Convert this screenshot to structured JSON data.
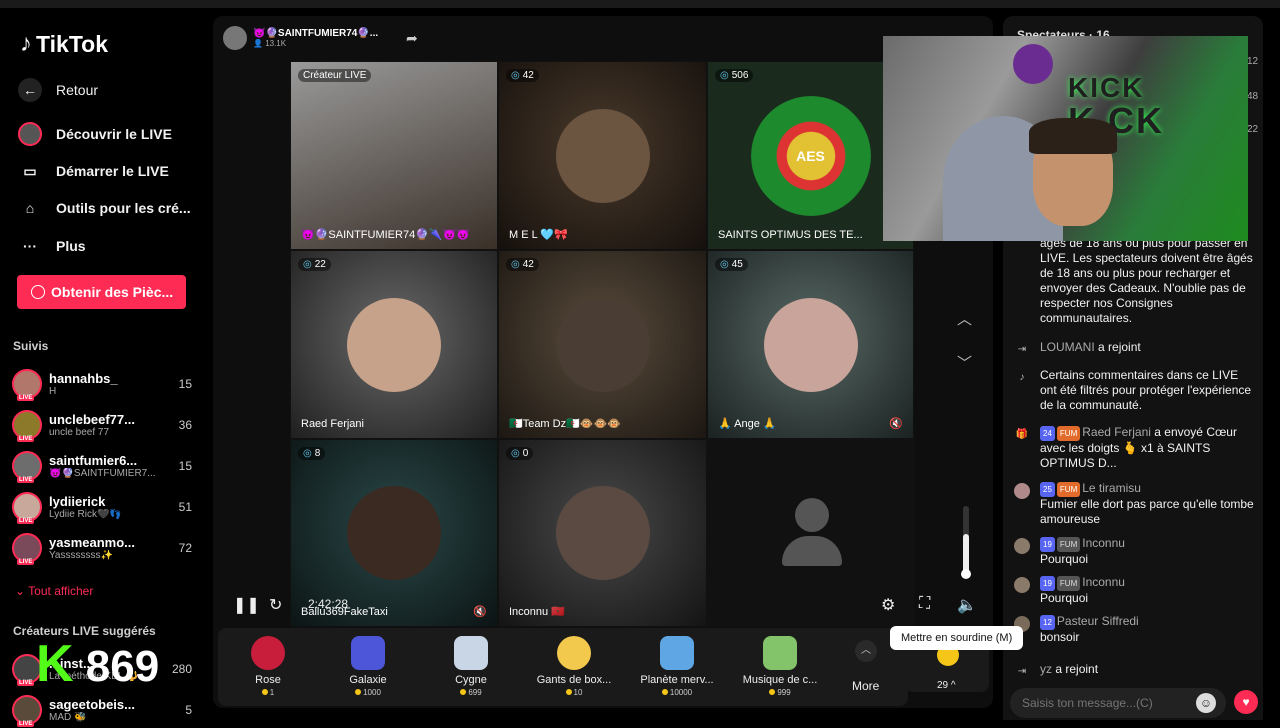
{
  "app": {
    "name": "TikTok"
  },
  "sidebar": {
    "back_label": "Retour",
    "nav": [
      {
        "label": "Découvrir le LIVE",
        "icon": "discover-live-icon"
      },
      {
        "label": "Démarrer le LIVE",
        "icon": "camera-icon"
      },
      {
        "label": "Outils pour les cré...",
        "icon": "tools-icon"
      },
      {
        "label": "Plus",
        "icon": "more-dots-icon"
      }
    ],
    "coin_button": "Obtenir des Pièc...",
    "following_title": "Suivis",
    "following": [
      {
        "name": "hannahbs_",
        "sub": "H",
        "count": "15"
      },
      {
        "name": "unclebeef77...",
        "sub": "uncle beef 77",
        "count": "36"
      },
      {
        "name": "saintfumier6...",
        "sub": "😈🔮SAINTFUMIER7...",
        "count": "15"
      },
      {
        "name": "lydiierick",
        "sub": "Lydiie Rick🖤👣",
        "count": "51"
      },
      {
        "name": "yasmeanmo...",
        "sub": "Yassssssss✨",
        "count": "72"
      }
    ],
    "show_all": "Tout afficher",
    "suggested_title": "Créateurs LIVE suggérés",
    "suggested": [
      {
        "name": "...inst...",
        "sub": "La méthode KBL 🔱",
        "count": "280"
      },
      {
        "name": "sageetobeis...",
        "sub": "MAD 🐝",
        "count": "5"
      }
    ]
  },
  "host": {
    "name": "😈🔮SAINTFUMIER74🔮...",
    "viewers": "13.1K"
  },
  "tiles": [
    {
      "count": "",
      "badge": "Créateur LIVE",
      "name": "😈🔮SAINTFUMIER74🔮🌂😈😈",
      "bg": "#8a8a8a"
    },
    {
      "count": "42",
      "name": "M E L 🩵🎀",
      "bg": "#3a3028"
    },
    {
      "count": "506",
      "name": "SAINTS OPTIMUS DES TE...",
      "bg": "#1e6a2a",
      "logo_text": "AES"
    },
    {
      "count": "22",
      "name": "Raed Ferjani",
      "bg": "#5a5a5a"
    },
    {
      "count": "42",
      "name": "🇩🇿Team Dz🇩🇿🐵🐵🐵",
      "bg": "#3b3227"
    },
    {
      "count": "45",
      "name": "🙏 Ange 🙏",
      "bg": "#3a4a48"
    },
    {
      "count": "8",
      "name": "Ballu369FakeTaxi",
      "bg": "#1e3030"
    },
    {
      "count": "0",
      "name": "Inconnu 🇲🇦",
      "bg": "#333333"
    },
    {
      "count": "",
      "name": "",
      "bg": "#101010"
    }
  ],
  "player": {
    "timer": "2:42:28",
    "tooltip": "Mettre en sourdine (M)"
  },
  "gifts": [
    {
      "name": "Rose",
      "price": "1",
      "color": "#c81d3b"
    },
    {
      "name": "Galaxie",
      "price": "1000",
      "color": "#4d55d8"
    },
    {
      "name": "Cygne",
      "price": "699",
      "color": "#c9d6e5"
    },
    {
      "name": "Gants de box...",
      "price": "10",
      "color": "#f2c94c"
    },
    {
      "name": "Planète merv...",
      "price": "10000",
      "color": "#5fa7e4"
    },
    {
      "name": "Musique de c...",
      "price": "999",
      "color": "#83c36a"
    }
  ],
  "more_label": "More",
  "coin_count": "29",
  "chat": {
    "header": "Spectateurs · 16",
    "right_numbers": [
      "12",
      "48",
      "22"
    ],
    "messages": [
      {
        "user": "",
        "text": "âgés de 18 ans ou plus pour passer en LIVE. Les spectateurs doivent être âgés de 18 ans ou plus pour recharger et envoyer des Cadeaux. N'oublie pas de respecter nos Consignes communautaires."
      },
      {
        "user": "LOUMANI",
        "text": "a rejoint"
      },
      {
        "user": "",
        "text": "Certains commentaires dans ce LIVE ont été filtrés pour protéger l'expérience de la communauté."
      },
      {
        "user": "Raed Ferjani",
        "text": "a envoyé Cœur avec les doigts 🫰 x1 à SAINTS OPTIMUS D..."
      },
      {
        "user": "Le tiramisu",
        "text": "Fumier elle dort pas parce qu'elle tombe amoureuse"
      },
      {
        "user": "Inconnu",
        "text": "Pourquoi"
      },
      {
        "user": "Inconnu",
        "text": "Pourquoi"
      },
      {
        "user": "Pasteur Siffredi",
        "text": "bonsoir"
      },
      {
        "user": "yz",
        "text": "a rejoint"
      }
    ],
    "badges": [
      "24",
      "FUM",
      "25",
      "FUM",
      "19",
      "FUM",
      "19",
      "FUM",
      "12"
    ],
    "input_placeholder": "Saisis ton message...(C)"
  },
  "overlay": {
    "kick_text": "KICK",
    "kick_number": "869"
  }
}
